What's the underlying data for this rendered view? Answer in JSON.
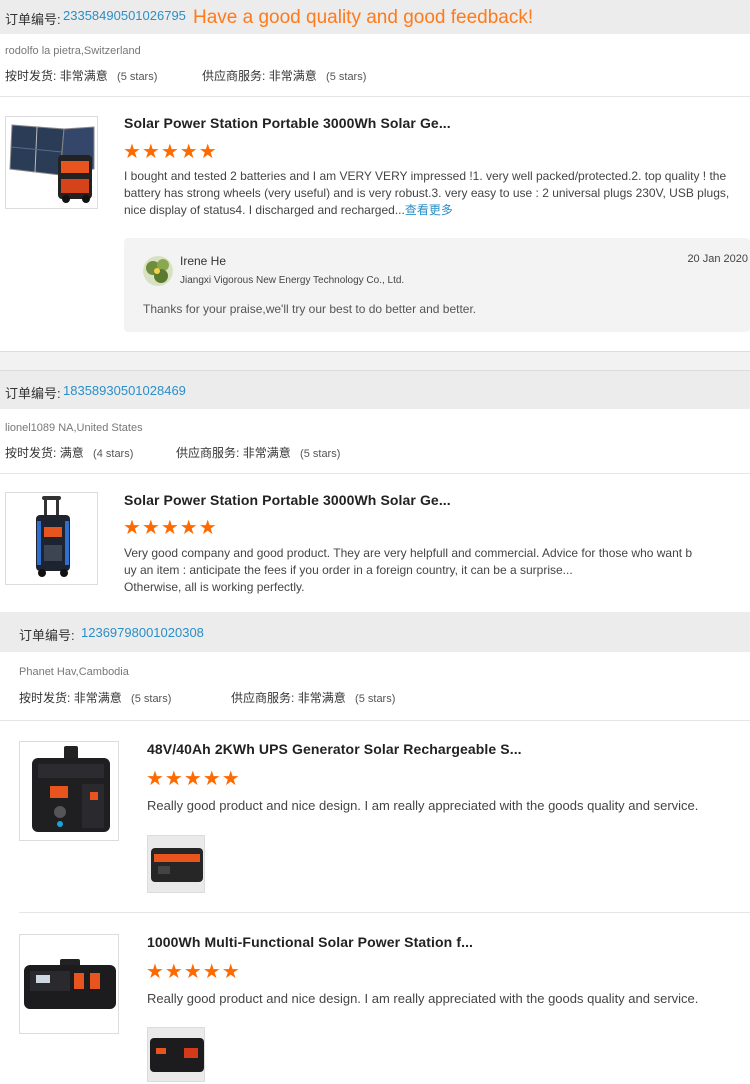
{
  "order_label": "订单编号:",
  "headline": "Have a good quality and good feedback!",
  "ship_label": "按时发货:",
  "service_label": "供应商服务:",
  "orders": [
    {
      "number": "23358490501026795",
      "buyer": "rodolfo la pietra,Switzerland",
      "ship_rating": "非常满意",
      "ship_stars": "(5 stars)",
      "service_rating": "非常满意",
      "service_stars": "(5 stars)",
      "products": [
        {
          "title": "Solar Power Station Portable 3000Wh Solar Ge...",
          "stars": 5,
          "review": "I bought and tested 2 batteries and I am VERY VERY impressed !1. very well packed/protected.2. top quality ! the battery has strong wheels (very useful) and is very robust.3. very easy to use : 2 universal plugs 230V, USB plugs, nice display of status4.  I discharged and recharged...",
          "more": "查看更多",
          "reply": {
            "name": "Irene He",
            "company": "Jiangxi Vigorous New Energy Technology Co., Ltd.",
            "date": "20 Jan 2020",
            "message": "Thanks for your praise,we'll try our best to do better and better."
          }
        }
      ]
    },
    {
      "number": "18358930501028469",
      "buyer": "lionel1089 NA,United States",
      "ship_rating": "满意",
      "ship_stars": "(4 stars)",
      "service_rating": "非常满意",
      "service_stars": "(5 stars)",
      "products": [
        {
          "title": "Solar Power Station Portable 3000Wh Solar Ge...",
          "stars": 5,
          "review_lines": [
            "Very good company and good product. They are very helpfull and commercial. Advice for those who want b",
            "uy an item : anticipate the fees if you order in a foreign country, it can be a surprise...",
            "Otherwise, all is working perfectly."
          ]
        }
      ]
    },
    {
      "number": "12369798001020308",
      "buyer": "Phanet Hav,Cambodia",
      "ship_rating": "非常满意",
      "ship_stars": "(5 stars)",
      "service_rating": "非常满意",
      "service_stars": "(5 stars)",
      "products": [
        {
          "title": "48V/40Ah 2KWh UPS Generator Solar Rechargeable S...",
          "stars": 5,
          "review": "Really good product and nice design. I am really appreciated with the goods quality and service."
        },
        {
          "title": "1000Wh Multi-Functional Solar Power Station f...",
          "stars": 5,
          "review": "Really good product and nice design. I am really appreciated with the goods quality and service."
        }
      ]
    }
  ],
  "star_glyphs": "★★★★★",
  "colors": {
    "accent": "#ff6a00",
    "link": "#2a8fc7",
    "headline": "#ff7a1a"
  }
}
